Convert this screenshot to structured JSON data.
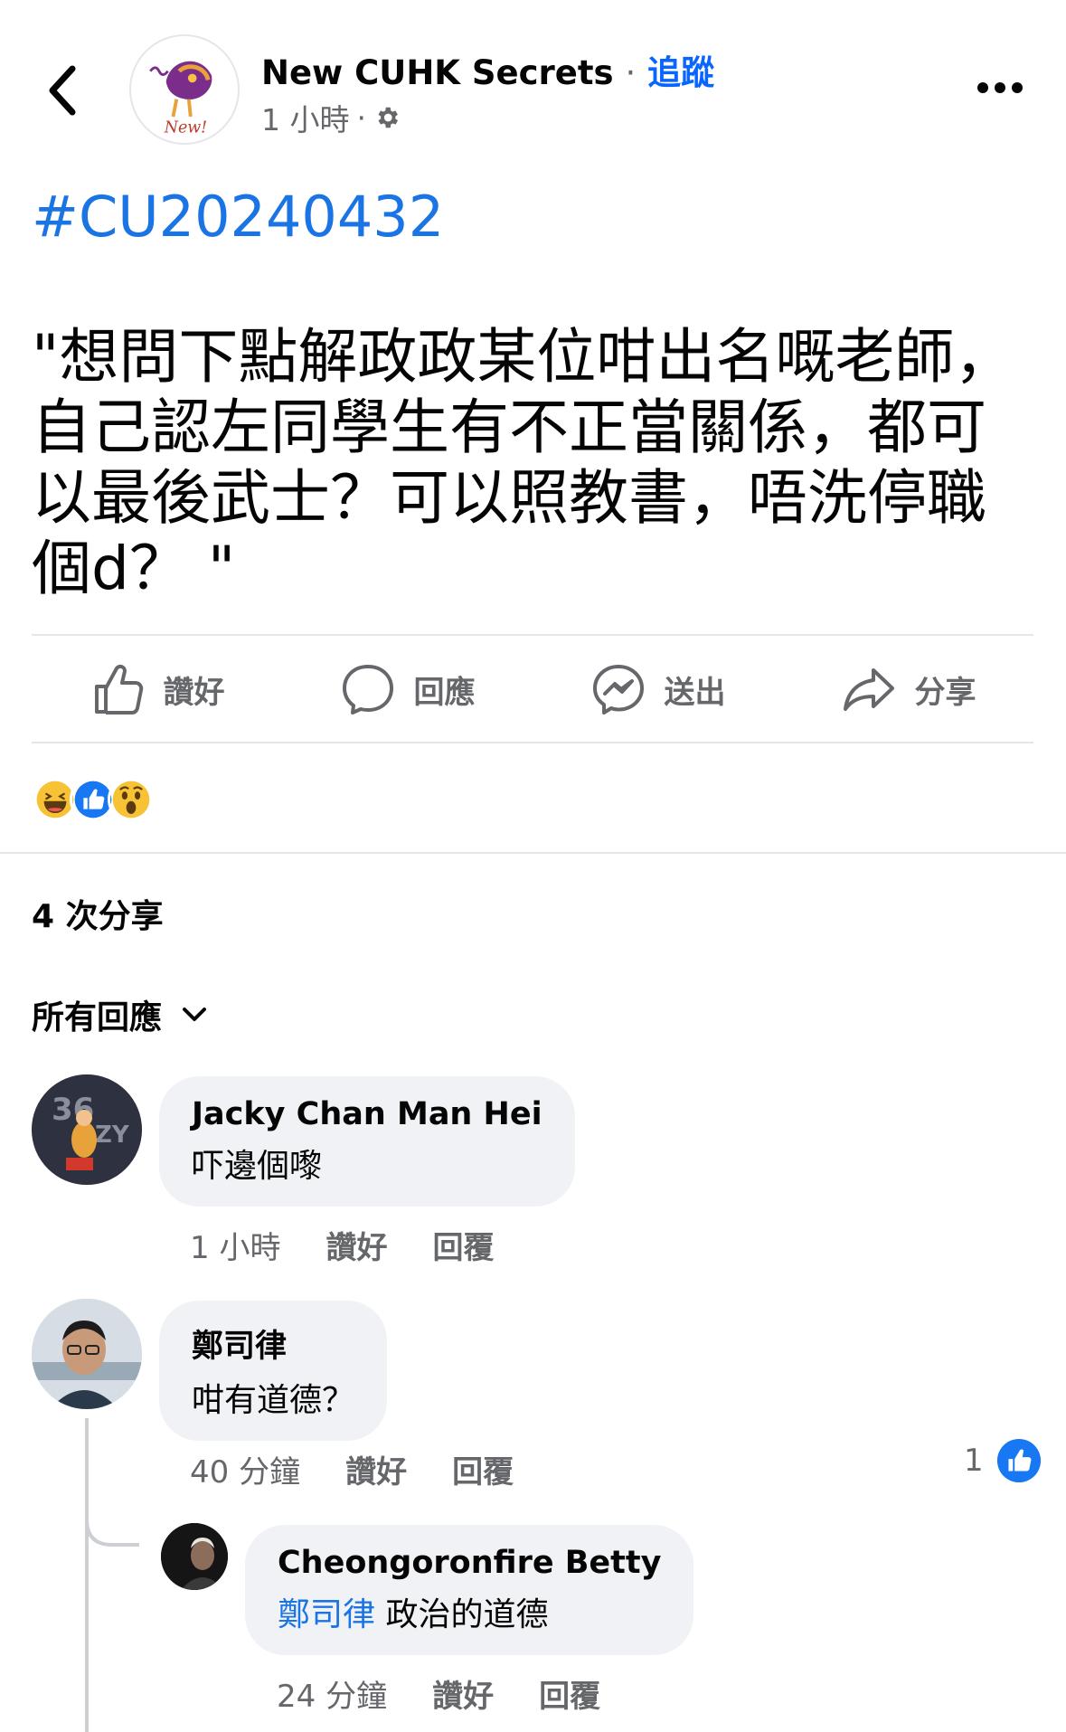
{
  "header": {
    "page_name": "New CUHK Secrets",
    "separator": "·",
    "follow_label": "追蹤",
    "time": "1 小時",
    "dot": "·",
    "avatar_text": "New!"
  },
  "post": {
    "hashtag": "#CU20240432",
    "text": "\"想問下點解政政某位咁出名嘅老師，\n自己認左同學生有不正當關係，都可\n以最後武士？可以照教書，唔洗停職\n個d？ \""
  },
  "actions": [
    {
      "label": "讚好",
      "icon": "like-icon"
    },
    {
      "label": "回應",
      "icon": "comment-icon"
    },
    {
      "label": "送出",
      "icon": "messenger-icon"
    },
    {
      "label": "分享",
      "icon": "share-icon"
    }
  ],
  "reactions": [
    "haha",
    "like",
    "wow"
  ],
  "shares_label": "4 次分享",
  "filter_label": "所有回應",
  "comments": [
    {
      "name": "Jacky Chan Man Hei",
      "text": "吓邊個嚟",
      "time": "1 小時",
      "like": "讚好",
      "reply": "回覆"
    },
    {
      "name": "鄭司律",
      "text": "咁有道德？",
      "time": "40 分鐘",
      "like": "讚好",
      "reply": "回覆",
      "like_count": "1"
    },
    {
      "name": "Cheongoronfire Betty",
      "mention": "鄭司律",
      "text": "政治的道德",
      "time": "24 分鐘",
      "like": "讚好",
      "reply": "回覆"
    }
  ],
  "colors": {
    "link": "#1b74e4",
    "follow": "#0866ff",
    "secondary": "#65676b",
    "bubble": "#f0f2f5"
  }
}
